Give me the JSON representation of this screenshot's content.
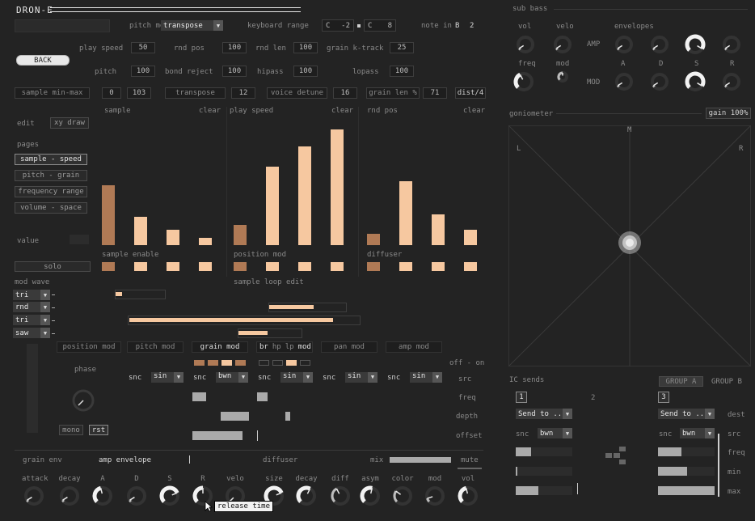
{
  "app": {
    "logo": "DRON-E"
  },
  "colors": {
    "bar_dark": "#b07a55",
    "bar_light": "#f6c8a0",
    "bg": "#232323",
    "accent_text": "#e8e8e8"
  },
  "header": {
    "pitch_mode_label": "pitch mode",
    "pitch_mode_value": "transpose",
    "keyboard_range_label": "keyboard range",
    "kr_low_note": "C",
    "kr_low_oct": "-2",
    "kr_high_note": "C",
    "kr_high_oct": "8",
    "note_in_label": "note in",
    "note_in_note": "B",
    "note_in_oct": "2"
  },
  "back_label": "BACK",
  "params": {
    "play_speed": {
      "label": "play speed",
      "value": "50"
    },
    "rnd_pos": {
      "label": "rnd pos",
      "value": "100"
    },
    "rnd_len": {
      "label": "rnd len",
      "value": "100"
    },
    "grain_ktrack": {
      "label": "grain k-track",
      "value": "25"
    },
    "pitch": {
      "label": "pitch",
      "value": "100"
    },
    "bond_reject": {
      "label": "bond reject",
      "value": "100"
    },
    "hipass": {
      "label": "hipass",
      "value": "100"
    },
    "lopass": {
      "label": "lopass",
      "value": "100"
    }
  },
  "row3": {
    "sample_minmax_label": "sample min-max",
    "sample_min": "0",
    "sample_max": "103",
    "transpose_label": "transpose",
    "transpose_value": "12",
    "voice_detune_label": "voice detune",
    "voice_detune_value": "16",
    "grain_len_label": "grain len %",
    "grain_len_value": "71",
    "dist_label": "dist/4"
  },
  "seq": {
    "sample_label": "sample",
    "play_speed_label": "play speed",
    "rnd_pos_label": "rnd pos",
    "clear_label": "clear",
    "sample_enable_label": "sample enable",
    "position_mod_label": "position mod",
    "diffuser_label": "diffuser",
    "sample_loop_edit_label": "sample loop edit",
    "groups": [
      {
        "values": [
          0.6,
          0.28,
          0.15,
          0.07
        ]
      },
      {
        "values": [
          0.2,
          0.78,
          0.98,
          1.15
        ]
      },
      {
        "values": [
          0.11,
          0.64,
          0.31,
          0.15
        ]
      }
    ],
    "enable": [
      1,
      1,
      1,
      1,
      1,
      1,
      1,
      1,
      1,
      1,
      1,
      1
    ]
  },
  "left": {
    "edit_label": "edit",
    "xy_draw_label": "xy draw",
    "pages_label": "pages",
    "pages": [
      "sample - speed",
      "pitch - grain",
      "frequency range",
      "volume - space"
    ],
    "value_label": "value",
    "solo_label": "solo",
    "mod_wave_label": "mod wave",
    "waves": [
      "tri",
      "rnd",
      "tri",
      "saw"
    ]
  },
  "loops": [
    {
      "start": 0.0,
      "end": 0.05
    },
    {
      "start": 0.35,
      "end": 0.55
    },
    {
      "start": 0.03,
      "end": 0.86
    },
    {
      "start": 0.29,
      "end": 0.42
    }
  ],
  "mod": {
    "position_mod_label": "position mod",
    "phase_label": "phase",
    "mono_label": "mono",
    "rst_label": "rst",
    "pitch_mod_label": "pitch mod",
    "grain_mod_label": "grain mod",
    "filter_mod_label": "mod",
    "filter_br": "br",
    "filter_hp": "hp",
    "filter_lp": "lp",
    "pan_mod_label": "pan mod",
    "amp_mod_label": "amp mod",
    "off_on_label": "off - on",
    "src_label": "src",
    "freq_label": "freq",
    "depth_label": "depth",
    "offset_label": "offset",
    "snc": "snc",
    "srcs": [
      "sin",
      "bwn",
      "sin",
      "sin",
      "sin"
    ],
    "freq": [
      0.0,
      0.19,
      0.0,
      0.0,
      0.0
    ],
    "depth": [
      0.0,
      0.4,
      0.08,
      0.0,
      0.0
    ]
  },
  "bottom": {
    "grain_env_label": "grain env",
    "amp_env_label": "amp envelope",
    "diffuser_label": "diffuser",
    "mix_label": "mix",
    "mute_label": "mute",
    "knobs": [
      "attack",
      "decay",
      "A",
      "D",
      "S",
      "R",
      "velo",
      "size",
      "decay",
      "diff",
      "asym",
      "color",
      "mod",
      "vol"
    ],
    "tooltip": "release time"
  },
  "sub_bass": {
    "title": "sub bass",
    "vol": "vol",
    "velo": "velo",
    "envelopes": "envelopes",
    "amp": "AMP",
    "mod": "MOD",
    "freq": "freq",
    "mod_k": "mod",
    "A": "A",
    "D": "D",
    "S": "S",
    "R": "R"
  },
  "gonio": {
    "title": "goniometer",
    "gain": "gain 100%",
    "M": "M",
    "L": "L",
    "R": "R"
  },
  "ic": {
    "title": "IC sends",
    "group_a": "GROUP A",
    "group_b": "GROUP B",
    "ch1": "1",
    "ch2": "2",
    "ch3": "3",
    "send": "Send to ..",
    "snc": "snc",
    "src": "bwn",
    "dest": "dest",
    "src_label": "src",
    "freq": "freq",
    "min": "min",
    "max": "max"
  }
}
